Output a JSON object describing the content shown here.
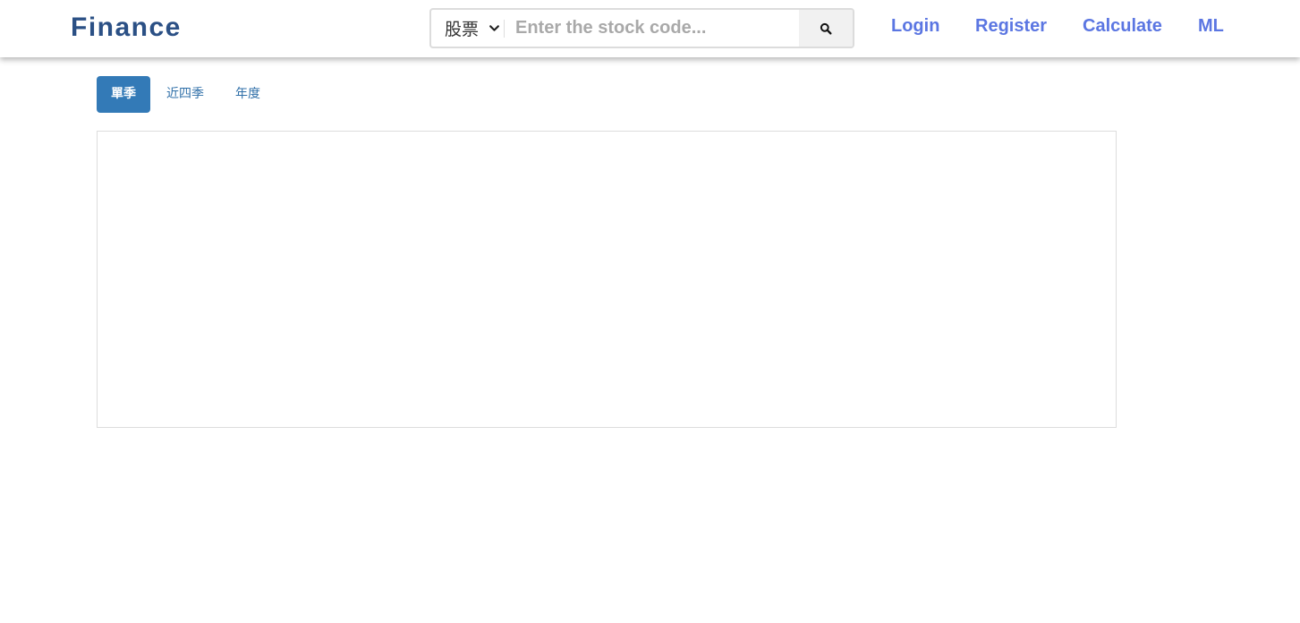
{
  "brand": {
    "title": "Finance",
    "color": "#2b5085"
  },
  "search": {
    "market_selected": "股票",
    "placeholder": "Enter the stock code...",
    "value": "",
    "button_icon": "search-icon"
  },
  "nav": {
    "links": [
      {
        "label": "Login"
      },
      {
        "label": "Register"
      },
      {
        "label": "Calculate"
      },
      {
        "label": "ML"
      }
    ],
    "link_color": "#5b76e2"
  },
  "period_tabs": {
    "items": [
      {
        "label": "單季",
        "active": true
      },
      {
        "label": "近四季",
        "active": false
      },
      {
        "label": "年度",
        "active": false
      }
    ],
    "active_color": "#337ab7"
  }
}
